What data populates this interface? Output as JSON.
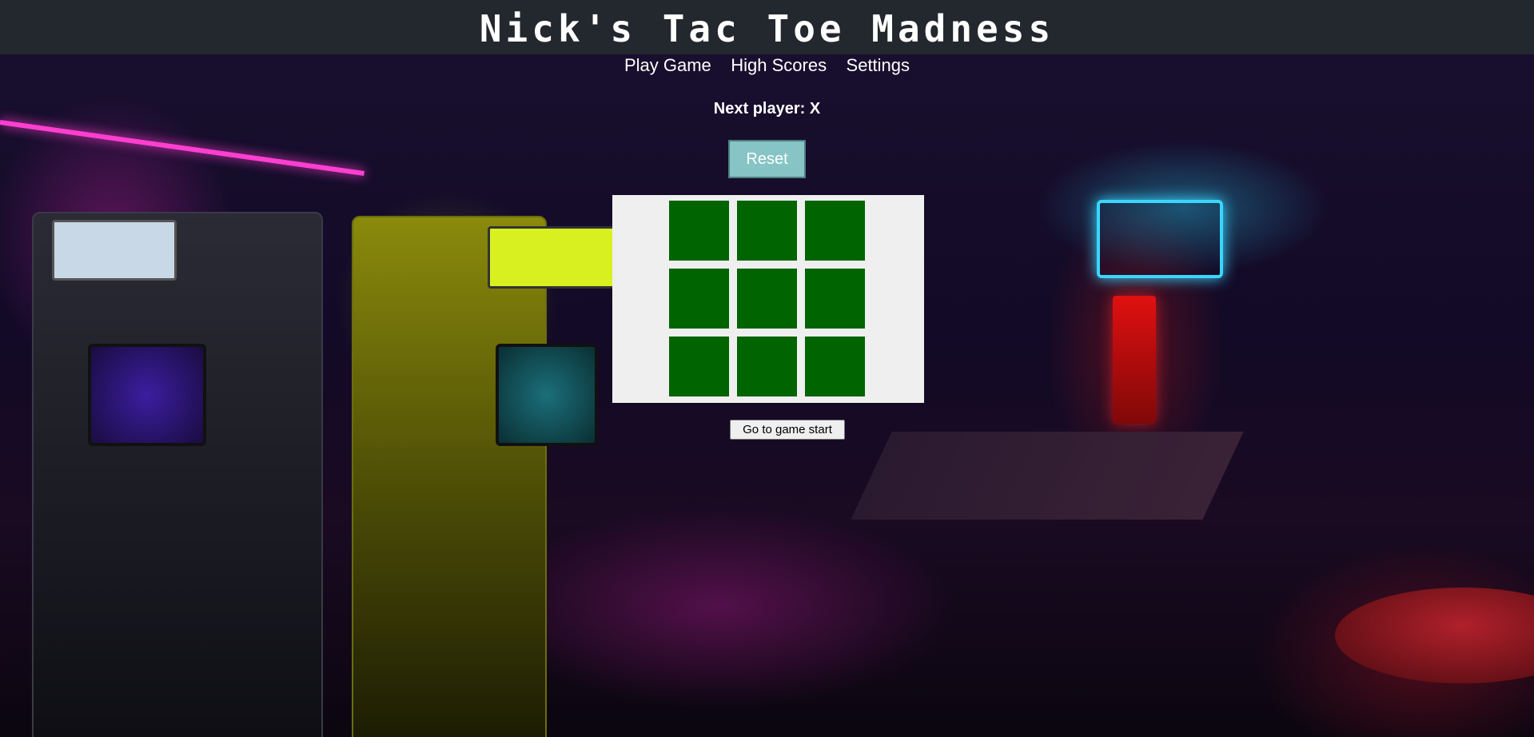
{
  "header": {
    "title": "Nick's Tac Toe Madness"
  },
  "nav": {
    "items": [
      {
        "label": "Play Game"
      },
      {
        "label": "High Scores"
      },
      {
        "label": "Settings"
      }
    ]
  },
  "game": {
    "status": "Next player: X",
    "reset_label": "Reset",
    "board": [
      "",
      "",
      "",
      "",
      "",
      "",
      "",
      "",
      ""
    ],
    "go_to_start_label": "Go to game start"
  },
  "colors": {
    "header_bg": "#23272e",
    "cell_fill": "#006400",
    "reset_bg": "#86c4c5",
    "board_panel_bg": "#efefef"
  }
}
